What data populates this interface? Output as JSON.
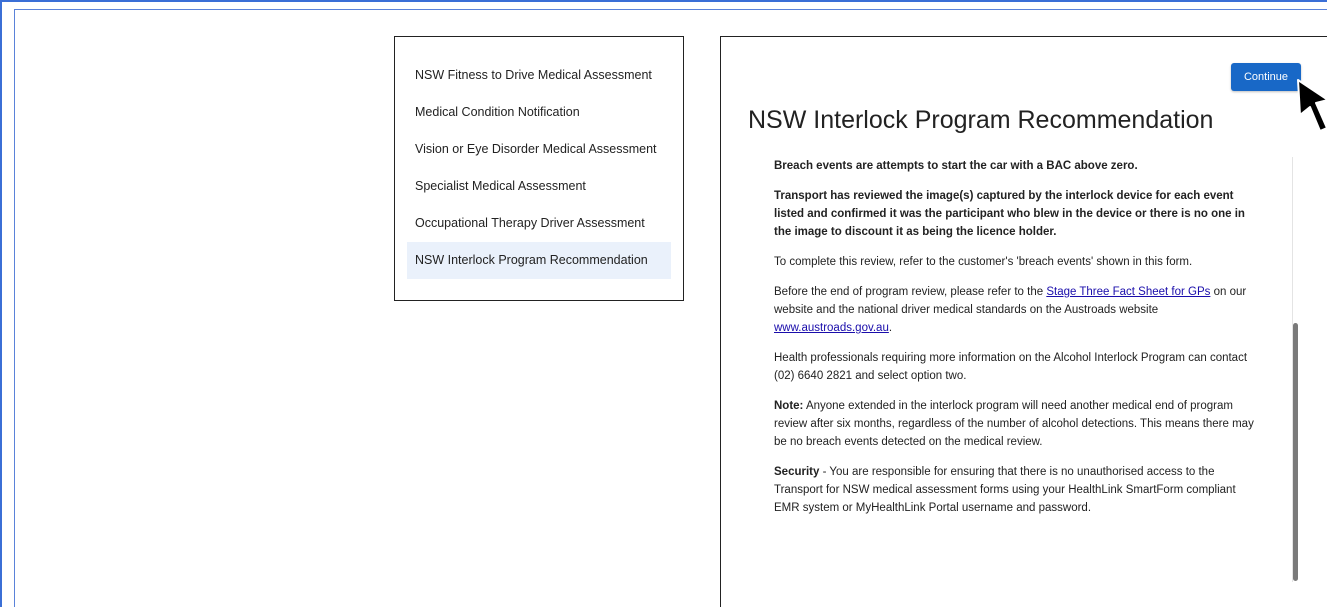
{
  "nav": {
    "items": [
      {
        "label": "NSW Fitness to Drive Medical Assessment",
        "active": false
      },
      {
        "label": "Medical Condition Notification",
        "active": false
      },
      {
        "label": "Vision or Eye Disorder Medical Assessment",
        "active": false
      },
      {
        "label": "Specialist Medical Assessment",
        "active": false
      },
      {
        "label": "Occupational Therapy Driver Assessment",
        "active": false
      },
      {
        "label": "NSW Interlock Program Recommendation",
        "active": true
      }
    ]
  },
  "main": {
    "continue_label": "Continue",
    "title": "NSW Interlock Program Recommendation",
    "breach_events": "Breach events are attempts to start the car with a BAC above zero.",
    "transport_review": "Transport has reviewed the image(s) captured by the interlock device for each event listed and confirmed it was the participant who blew in the device or there is no one in the image to discount it as being the licence holder.",
    "complete_review": "To complete this review, refer to the customer's 'breach events' shown in this form.",
    "before_end_pre": "Before the end of program review, please refer to the ",
    "fact_sheet_link": "Stage Three Fact Sheet for GPs",
    "before_end_mid": " on our website and the national driver medical standards on the Austroads website ",
    "austroads_link": "www.austroads.gov.au",
    "before_end_post": ".",
    "health_professionals": "Health professionals requiring more information on the Alcohol Interlock Program can contact (02) 6640 2821 and select option two.",
    "note_label": "Note:",
    "note_text": " Anyone extended in the interlock program will need another medical end of program review after six months, regardless of the number of alcohol detections. This means there may be no breach events detected on the medical review.",
    "security_label": "Security",
    "security_text": " - You are responsible for ensuring that there is no unauthorised access to the Transport for NSW medical assessment forms using your HealthLink SmartForm compliant EMR system or MyHealthLink Portal username and password."
  },
  "colors": {
    "accent": "#1868c7",
    "active_nav_bg": "#eaf1fb",
    "frame_border": "#3b6fd6"
  },
  "icons": {
    "cursor": "mouse-pointer-icon"
  }
}
